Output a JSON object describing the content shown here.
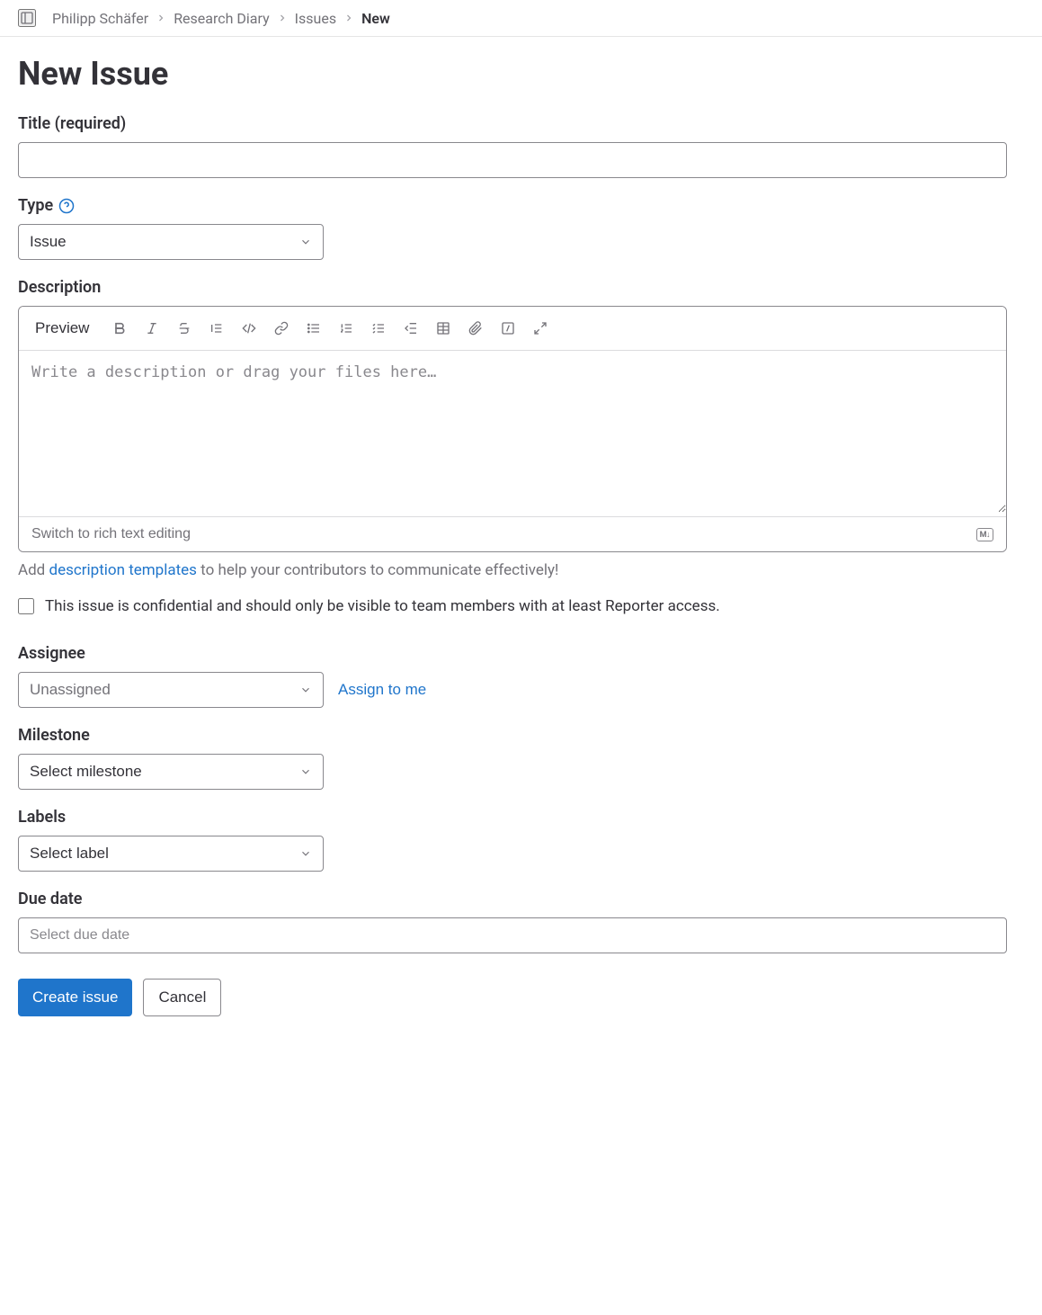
{
  "breadcrumbs": {
    "items": [
      {
        "label": "Philipp Schäfer"
      },
      {
        "label": "Research Diary"
      },
      {
        "label": "Issues"
      }
    ],
    "current": "New"
  },
  "page": {
    "title": "New Issue"
  },
  "form": {
    "title_label": "Title (required)",
    "title_value": "",
    "type_label": "Type",
    "type_value": "Issue",
    "description_label": "Description",
    "editor": {
      "preview": "Preview",
      "placeholder": "Write a description or drag your files here…",
      "switch_label": "Switch to rich text editing"
    },
    "helper": {
      "prefix": "Add ",
      "link": "description templates",
      "suffix": " to help your contributors to communicate effectively!"
    },
    "confidential": {
      "label": "This issue is confidential and should only be visible to team members with at least Reporter access."
    },
    "assignee_label": "Assignee",
    "assignee_value": "Unassigned",
    "assign_to_me": "Assign to me",
    "milestone_label": "Milestone",
    "milestone_value": "Select milestone",
    "labels_label": "Labels",
    "labels_value": "Select label",
    "due_date_label": "Due date",
    "due_date_placeholder": "Select due date",
    "submit": "Create issue",
    "cancel": "Cancel"
  }
}
